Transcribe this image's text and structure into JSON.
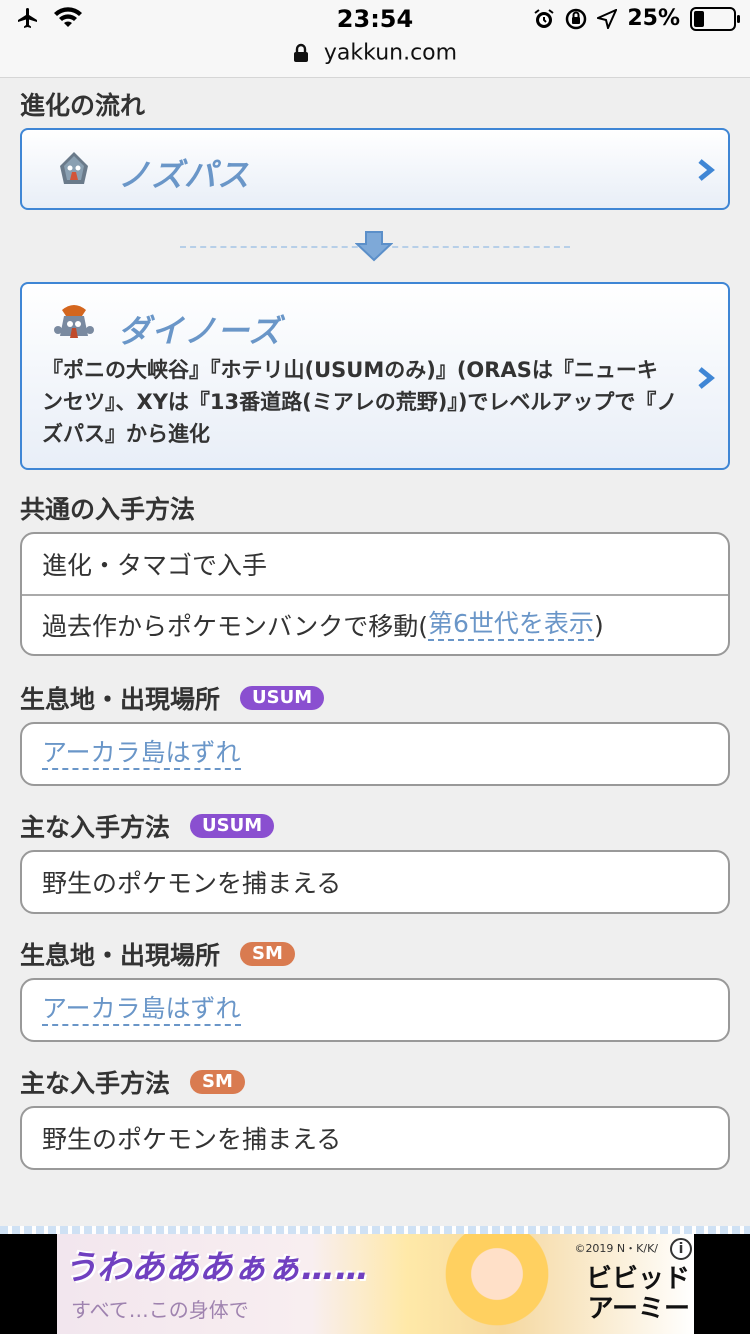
{
  "status_bar": {
    "time": "23:54",
    "battery_text": "25%",
    "battery_level": 0.25
  },
  "url_bar": {
    "url": "yakkun.com"
  },
  "evolution": {
    "title": "進化の流れ",
    "stages": [
      {
        "name": "ノズパス",
        "icon": "nosepass-sprite-icon"
      },
      {
        "name": "ダイノーズ",
        "icon": "probopass-sprite-icon",
        "method": "『ポニの大峡谷』『ホテリ山(USUMのみ)』(ORASは『ニューキンセツ』、XYは『13番道路(ミアレの荒野)』)でレベルアップで『ノズパス』から進化"
      }
    ]
  },
  "common_acquisition": {
    "title": "共通の入手方法",
    "rows": [
      {
        "text": "進化・タマゴで入手"
      },
      {
        "text": "過去作からポケモンバンクで移動(",
        "link": "第6世代を表示",
        "suffix": ")"
      }
    ]
  },
  "habitat_usum": {
    "title": "生息地・出現場所",
    "tag": "USUM",
    "location": "アーカラ島はずれ"
  },
  "method_usum": {
    "title": "主な入手方法",
    "tag": "USUM",
    "text": "野生のポケモンを捕まえる"
  },
  "habitat_sm": {
    "title": "生息地・出現場所",
    "tag": "SM",
    "location": "アーカラ島はずれ"
  },
  "method_sm": {
    "title": "主な入手方法",
    "tag": "SM",
    "text": "野生のポケモンを捕まえる"
  },
  "ad": {
    "headline": "うわあああぁぁ……",
    "sub": "すべて…この身体で",
    "copyright": "©2019 N・K/K/",
    "logo_line1": "ビビッド",
    "logo_line2": "アーミー",
    "info": "i"
  },
  "colors": {
    "accent": "#3f86d5",
    "link": "#6a96c8",
    "usum_tag": "#8a4fd0",
    "sm_tag": "#d97b50"
  }
}
